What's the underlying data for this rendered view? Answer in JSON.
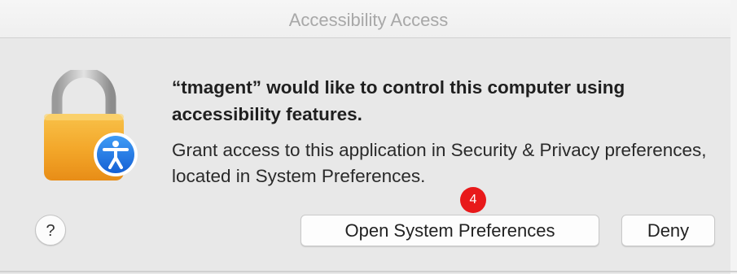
{
  "window": {
    "title": "Accessibility Access"
  },
  "dialog": {
    "heading": "“tmagent” would like to control this computer using accessibility features.",
    "body": "Grant access to this application in Security & Privacy preferences, located in System Preferences.",
    "icon": "lock-with-accessibility-icon"
  },
  "buttons": {
    "help_label": "?",
    "open_label": "Open System Preferences",
    "deny_label": "Deny"
  },
  "annotation": {
    "marker_label": "4",
    "marker_color": "#e8191a"
  }
}
